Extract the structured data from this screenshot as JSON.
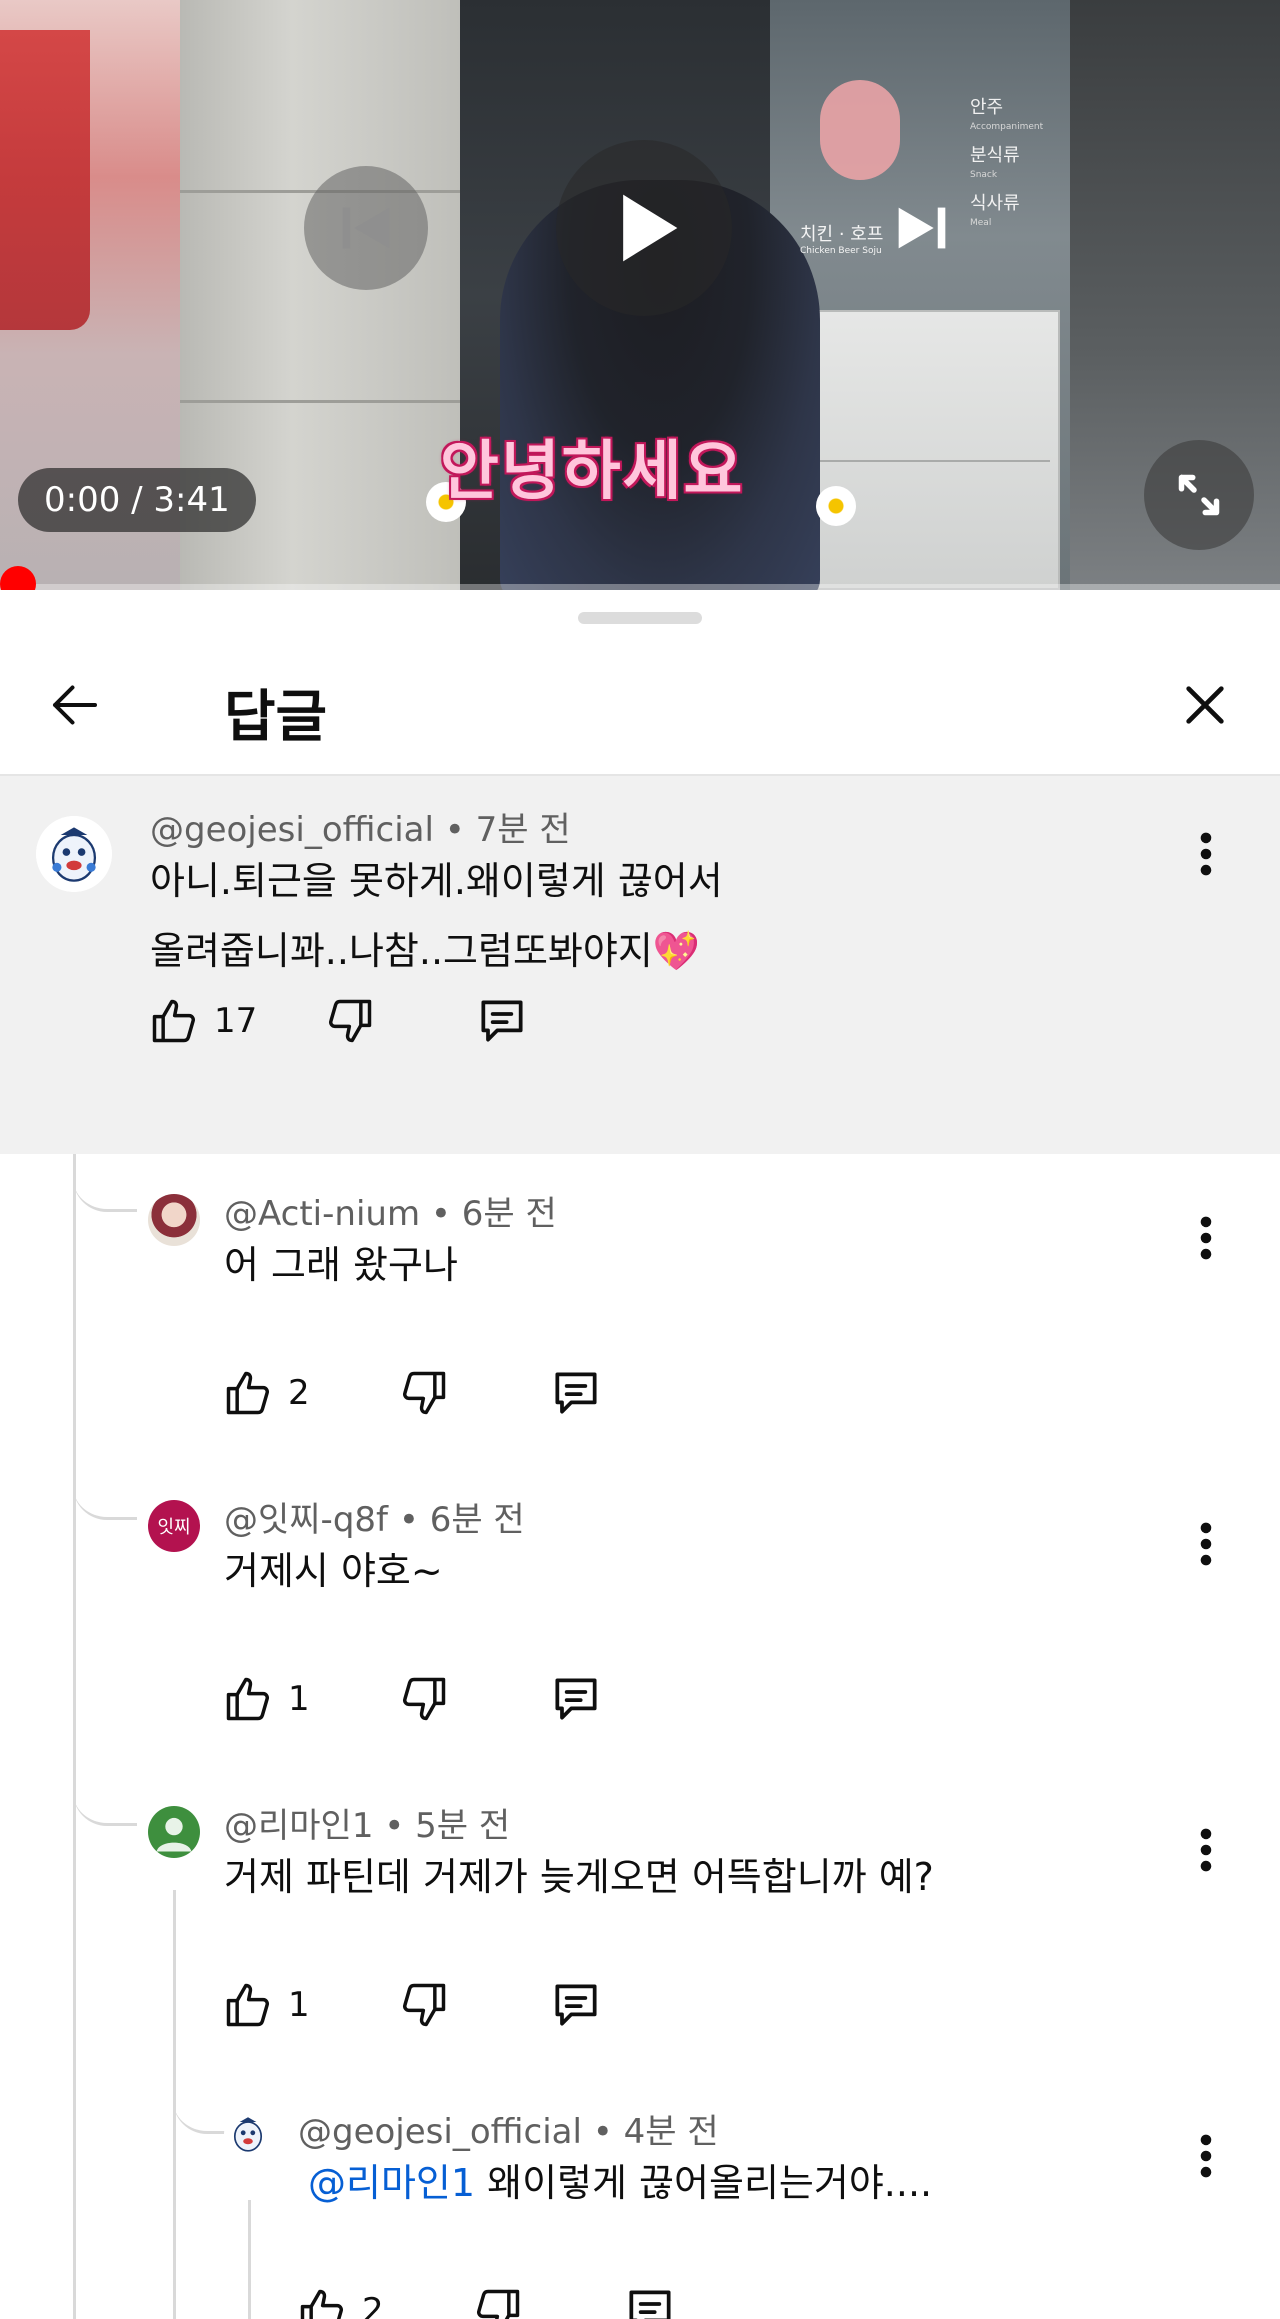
{
  "player": {
    "time_display": "0:00 / 3:41",
    "progress_fraction": 0.0,
    "overlay_caption": "안녕하세요",
    "sign_text": "치킨 · 호프",
    "sign_sub": "Chicken  Beer  Soju",
    "menu": [
      {
        "ko": "안주",
        "en": "Accompaniment"
      },
      {
        "ko": "분식류",
        "en": "Snack"
      },
      {
        "ko": "식사류",
        "en": "Meal"
      }
    ]
  },
  "sheet": {
    "title": "답글"
  },
  "comments": [
    {
      "handle": "@geojesi_official",
      "time": "7분 전",
      "lines": [
        "아니.퇴근을 못하게.왜이렇게 끊어서",
        "올려줍니꽈..나참..그럼또봐야지💖"
      ],
      "likes": "17"
    },
    {
      "handle": "@Acti-nium",
      "time": "6분 전",
      "text": "어 그래 왔구나",
      "likes": "2"
    },
    {
      "handle": "@잇찌-q8f",
      "time": "6분 전",
      "avatar_text": "잇찌",
      "text": "거제시 야호~",
      "likes": "1"
    },
    {
      "handle": "@리마인1",
      "time": "5분 전",
      "text": "거제 파틴데 거제가 늦게오면 어뜩합니까 예?",
      "likes": "1"
    },
    {
      "handle": "@geojesi_official",
      "time": "4분 전",
      "mention": "@리마인1",
      "text": " 왜이렇게 끊어올리는거야....",
      "likes": "2"
    }
  ],
  "colors": {
    "accent_red": "#ff0000",
    "mention_blue": "#065fd4",
    "highlight_bg": "#f1f1f1",
    "avatar_green": "#3e8f3e",
    "avatar_magenta": "#b3124f"
  }
}
